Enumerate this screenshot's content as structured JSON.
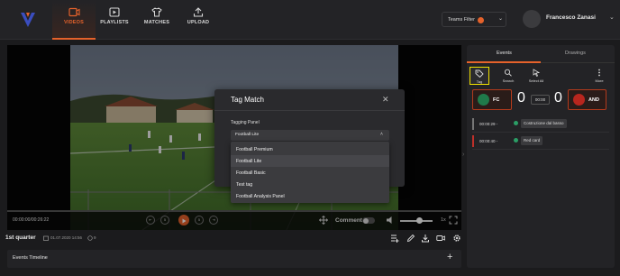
{
  "nav": {
    "items": [
      {
        "label": "VIDEOS",
        "icon": "video-icon",
        "active": true
      },
      {
        "label": "PLAYLISTS",
        "icon": "playlist-icon",
        "active": false
      },
      {
        "label": "MATCHES",
        "icon": "jersey-icon",
        "active": false
      },
      {
        "label": "UPLOAD",
        "icon": "upload-icon",
        "active": false
      }
    ]
  },
  "header": {
    "teams_filter": "Teams Filter",
    "user_name": "Francesco Zanasi"
  },
  "player": {
    "timecode": "00:00:00/00:26:22",
    "comment_label": "Comment",
    "comment_enabled": false,
    "speed": "1x",
    "volume": 0.55
  },
  "info": {
    "period": "1st quarter",
    "date": "01.07.2020 14:56",
    "count": "9"
  },
  "timeline": {
    "label": "Events Timeline"
  },
  "side_panel": {
    "tabs": [
      "Events",
      "Drawings"
    ],
    "active_tab": "Events",
    "tools": [
      {
        "label": "Tag",
        "icon": "tag-icon"
      },
      {
        "label": "Search",
        "icon": "search-icon"
      },
      {
        "label": "Select All",
        "icon": "cursor-icon"
      },
      {
        "label": "More",
        "icon": "more-vertical-icon"
      }
    ],
    "home": {
      "name": "FC",
      "score": "0"
    },
    "away": {
      "name": "AND",
      "score": "0"
    },
    "clock": "00:00",
    "events": [
      {
        "time": "00:00:29",
        "separator": "-",
        "tag": "Costruzione dal basso",
        "bar_color": "#777777"
      },
      {
        "time": "00:00:40",
        "separator": "-",
        "tag": "Red card",
        "bar_color": "#c0302a"
      }
    ]
  },
  "modal": {
    "title": "Tag Match",
    "field_label": "Tagging Panel",
    "selected": "Football Lite",
    "options": [
      "Football Premium",
      "Football Lite",
      "Football Basic",
      "Test tag",
      "Football Analysis Panel"
    ]
  },
  "colors": {
    "accent": "#e5622b",
    "highlight": "#f2e200",
    "panel_bg": "#232326",
    "page_bg": "#1b1b1d"
  }
}
